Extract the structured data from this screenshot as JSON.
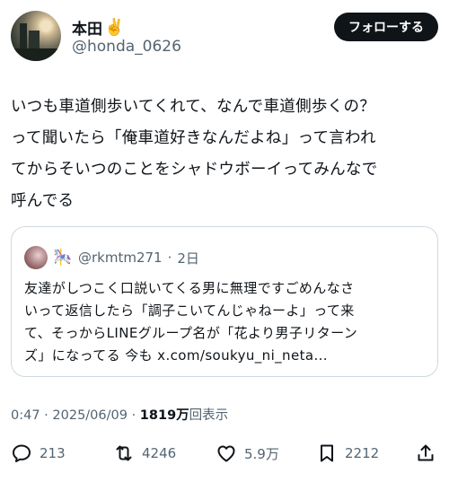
{
  "author": {
    "name": "本田",
    "emoji": "✌️",
    "handle": "@honda_0626"
  },
  "follow_label": "フォローする",
  "tweet": {
    "text": "いつも車道側歩いてくれて、なんで車道側歩くの？\nって聞いたら「俺車道好きなんだよね」って言われ\nてからそいつのことをシャドウボーイってみんなで\n呼んでる"
  },
  "quoted": {
    "badge_emoji": "🎠",
    "handle": "@rkmtm271",
    "separator": "·",
    "time": "2日",
    "text": "友達がしつこく口説いてくる男に無理ですごめんなさ\nいって返信したら「調子こいてんじゃねーよ」って来\nて、そっからLINEグループ名が「花より男子リターン\nズ」になってる 今も x.com/soukyu_ni_neta..."
  },
  "meta": {
    "time": "0:47",
    "sep": " · ",
    "date": "2025/06/09",
    "views": "1819万",
    "views_suffix": "回表示"
  },
  "actions": {
    "replies": "213",
    "reposts": "4246",
    "likes": "5.9万",
    "bookmarks": "2212"
  },
  "colors": {
    "text": "#0f1419",
    "secondary": "#536471",
    "border": "#cfd9de"
  }
}
